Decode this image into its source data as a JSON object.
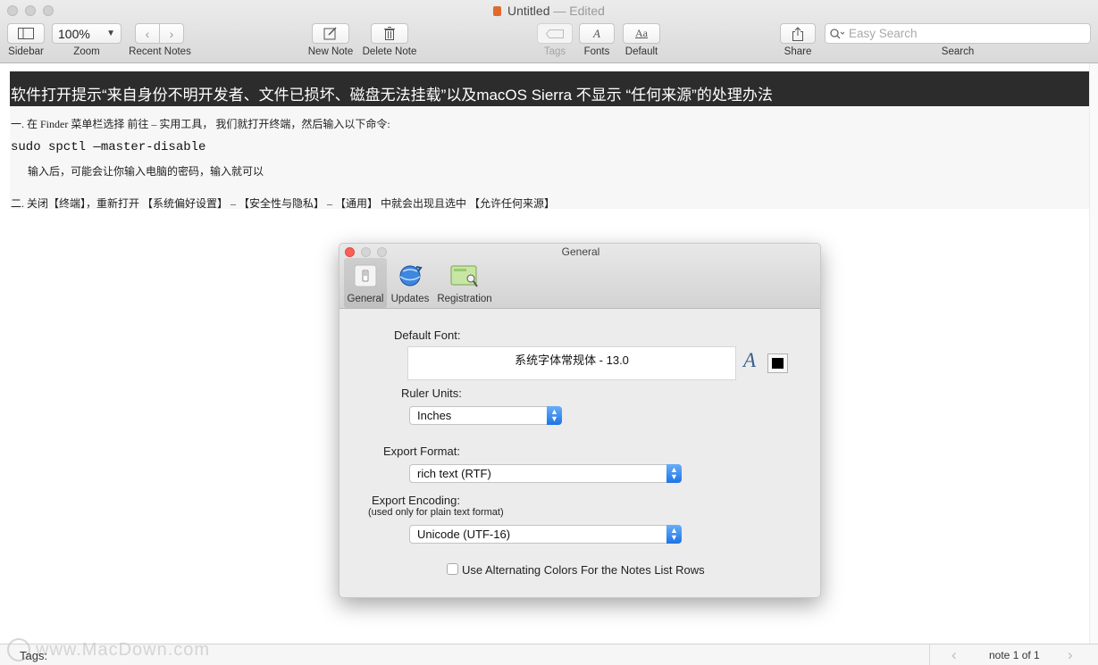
{
  "window": {
    "title": "Untitled",
    "status": "— Edited"
  },
  "toolbar": {
    "zoom_value": "100%",
    "labels": {
      "sidebar": "Sidebar",
      "zoom": "Zoom",
      "recent_notes": "Recent Notes",
      "new_note": "New Note",
      "delete_note": "Delete Note",
      "tags": "Tags",
      "fonts": "Fonts",
      "default": "Default",
      "share": "Share",
      "search": "Search"
    },
    "search_placeholder": "Easy Search"
  },
  "document": {
    "title": "软件打开提示“来自身份不明开发者、文件已损坏、磁盘无法挂载”以及macOS Sierra 不显示 “任何来源”的处理办法",
    "line1": "一. 在 Finder 菜单栏选择 前往 – 实用工具， 我们就打开终端，然后输入以下命令:",
    "command": "sudo spctl —master-disable",
    "line2": "输入后，可能会让你输入电脑的密码，输入就可以",
    "line3": "二. 关闭【终端】，重新打开 【系统偏好设置】 – 【安全性与隐私】 – 【通用】 中就会出现且选中 【允许任何来源】"
  },
  "footer": {
    "tags_label": "Tags:",
    "pager": "note 1 of 1",
    "watermark": "www.MacDown.com"
  },
  "prefs": {
    "title": "General",
    "tabs": [
      "General",
      "Updates",
      "Registration"
    ],
    "default_font_label": "Default Font:",
    "default_font_value": "系统字体常规体 - 13.0",
    "ruler_label": "Ruler Units:",
    "ruler_value": "Inches",
    "export_format_label": "Export Format:",
    "export_format_value": "rich text (RTF)",
    "export_encoding_label": "Export Encoding:",
    "export_encoding_note": "(used only for plain text format)",
    "export_encoding_value": "Unicode (UTF-16)",
    "alt_colors_label": "Use Alternating Colors For the Notes List Rows",
    "alt_colors_checked": false
  },
  "colors": {
    "title_bar_bg": "#2c2c2c",
    "close_red": "#fc5f57",
    "popup_blue": "#1d74e6",
    "font_color_well": "#000000"
  }
}
